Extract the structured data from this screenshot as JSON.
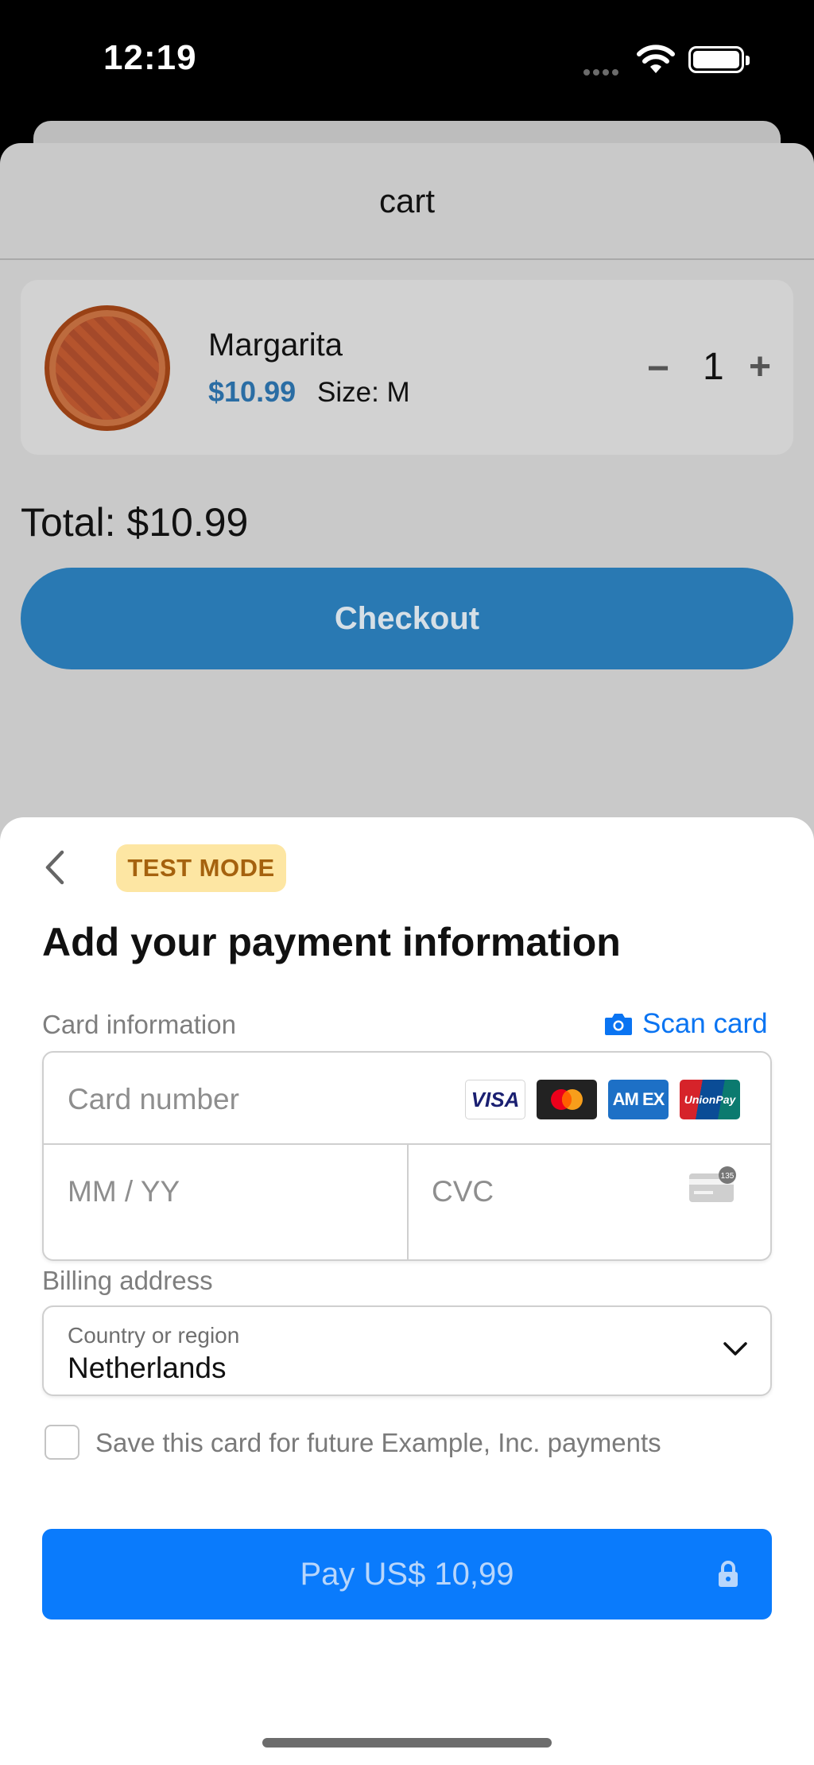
{
  "status_bar": {
    "time": "12:19"
  },
  "cart": {
    "title": "cart",
    "item": {
      "name": "Margarita",
      "price": "$10.99",
      "size": "Size: M",
      "quantity": "1",
      "minus": "−",
      "plus": "+"
    },
    "total": "Total: $10.99",
    "checkout_label": "Checkout"
  },
  "payment": {
    "test_badge": "TEST MODE",
    "title": "Add your payment information",
    "card_info_label": "Card information",
    "scan_card_label": "Scan card",
    "card_number_placeholder": "Card number",
    "expiry_placeholder": "MM / YY",
    "cvc_placeholder": "CVC",
    "cvc_badge": "135",
    "brands": {
      "visa": "VISA",
      "amex": "AM EX",
      "unionpay": "UnionPay"
    },
    "billing_label": "Billing address",
    "country_label": "Country or region",
    "country_value": "Netherlands",
    "save_card_label": "Save this card for future Example, Inc. payments",
    "pay_label": "Pay US$ 10,99"
  },
  "colors": {
    "accent": "#0a7bfc",
    "checkout": "#2979b3",
    "badge": "#fde6a3"
  }
}
